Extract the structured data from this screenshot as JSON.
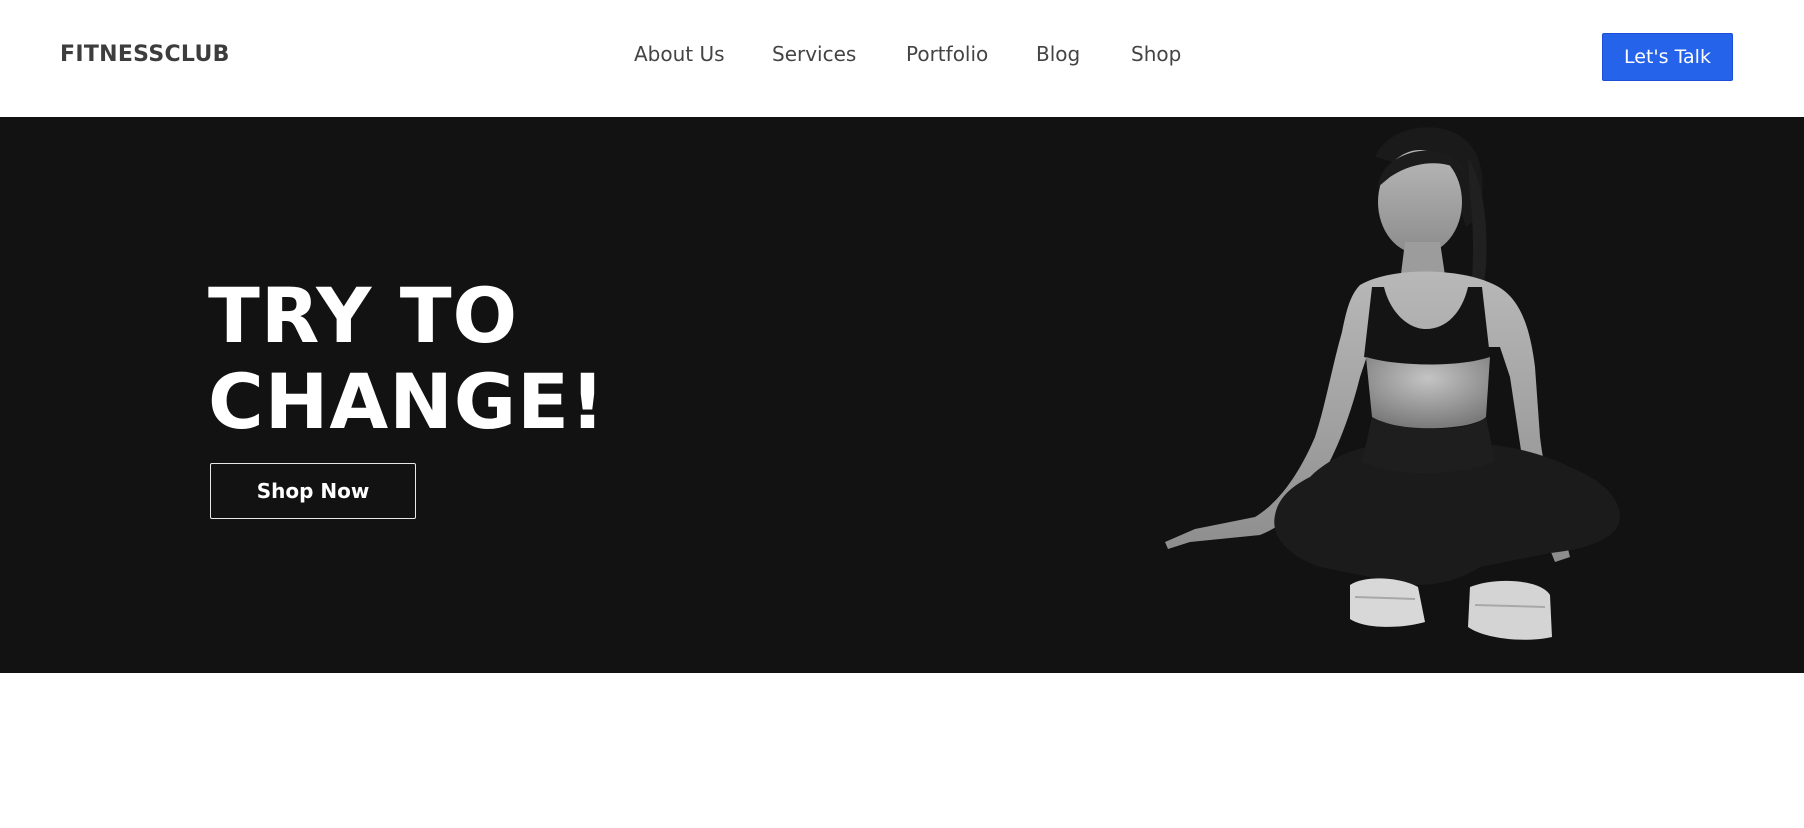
{
  "header": {
    "brand": "FITNESSCLUB",
    "nav": [
      {
        "label": "About Us"
      },
      {
        "label": "Services"
      },
      {
        "label": "Portfolio"
      },
      {
        "label": "Blog"
      },
      {
        "label": "Shop"
      }
    ],
    "cta_label": "Let's Talk"
  },
  "hero": {
    "headline_line1": "TRY TO",
    "headline_line2": "CHANGE!",
    "button_label": "Shop Now",
    "image_subject": "woman-sitting-cross-legged-photo"
  },
  "colors": {
    "accent": "#2563eb",
    "hero_background": "#121212",
    "header_background": "#ffffff",
    "text_dark": "#444444"
  }
}
